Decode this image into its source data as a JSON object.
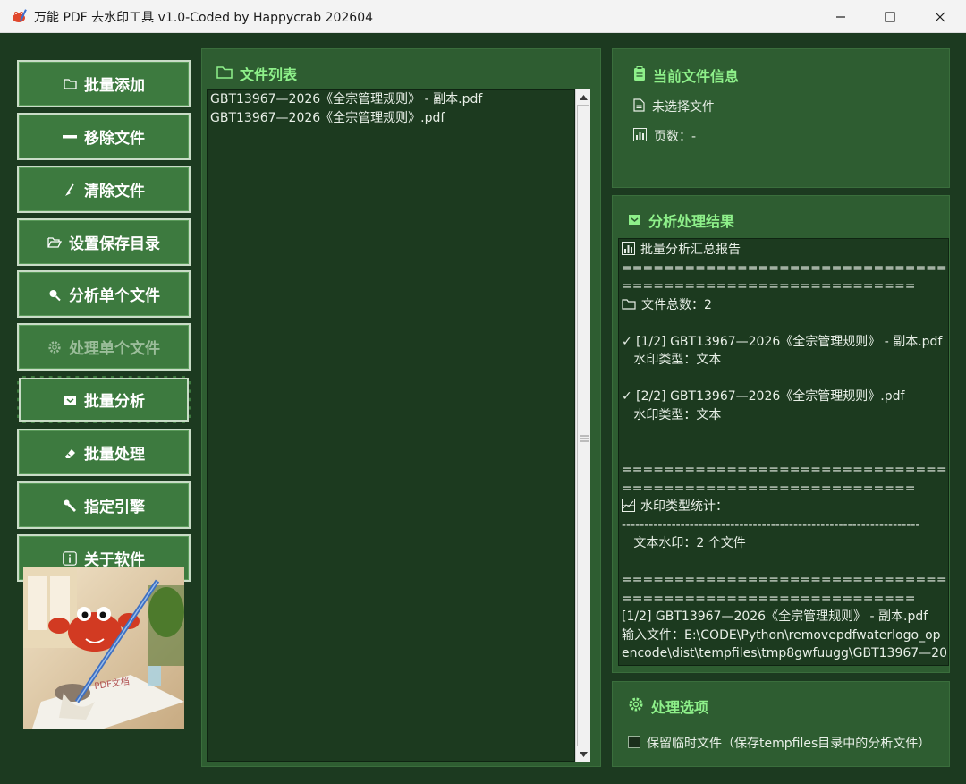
{
  "window": {
    "title": "万能 PDF 去水印工具 v1.0-Coded by Happycrab 202604"
  },
  "sidebar": {
    "buttons": [
      {
        "label": "批量添加",
        "icon": "folder-icon",
        "state": "normal"
      },
      {
        "label": "移除文件",
        "icon": "minus-icon",
        "state": "normal"
      },
      {
        "label": "清除文件",
        "icon": "broom-icon",
        "state": "normal"
      },
      {
        "label": "设置保存目录",
        "icon": "folder-open-icon",
        "state": "normal"
      },
      {
        "label": "分析单个文件",
        "icon": "magnifier-icon",
        "state": "normal"
      },
      {
        "label": "处理单个文件",
        "icon": "gear-icon",
        "state": "disabled"
      },
      {
        "label": "批量分析",
        "icon": "inbox-icon",
        "state": "focused"
      },
      {
        "label": "批量处理",
        "icon": "eraser-icon",
        "state": "normal"
      },
      {
        "label": "指定引擎",
        "icon": "wrench-icon",
        "state": "normal"
      },
      {
        "label": "关于软件",
        "icon": "info-icon",
        "state": "normal"
      }
    ]
  },
  "file_list": {
    "title": "文件列表",
    "items": [
      "GBT13967—2026《全宗管理规则》 - 副本.pdf",
      "GBT13967—2026《全宗管理规则》.pdf"
    ]
  },
  "current_file": {
    "title": "当前文件信息",
    "file_label": "未选择文件",
    "pages_label": "页数：-"
  },
  "analysis": {
    "title": "分析处理结果",
    "lines": [
      "批量分析汇总报告",
      "====================================",
      "============================",
      "文件总数：2",
      "",
      "✓ [1/2] GBT13967—2026《全宗管理规则》 - 副本.pdf",
      "   水印类型：文本",
      "",
      "✓ [2/2] GBT13967—2026《全宗管理规则》.pdf",
      "   水印类型：文本",
      "",
      "",
      "====================================",
      "============================",
      "水印类型统计：",
      "------------------------------------------------------------------",
      "   文本水印：2 个文件",
      "",
      "====================================",
      "============================",
      "[1/2] GBT13967—2026《全宗管理规则》 - 副本.pdf",
      "输入文件：E:\\CODE\\Python\\removepdfwaterlogo_op",
      "encode\\dist\\tempfiles\\tmp8gwfuugg\\GBT13967—20"
    ],
    "line_icons": {
      "0": "bar-chart-icon",
      "3": "folder-icon",
      "14": "stats-icon"
    }
  },
  "options": {
    "title": "处理选项",
    "keep_temp_label": "保留临时文件（保存tempfiles目录中的分析文件）",
    "keep_temp_checked": false
  },
  "colors": {
    "accent_title": "#8ef08a",
    "button_bg": "#3d7a3f",
    "panel_bg": "#2e5d31",
    "list_bg": "#1c3a1f"
  }
}
